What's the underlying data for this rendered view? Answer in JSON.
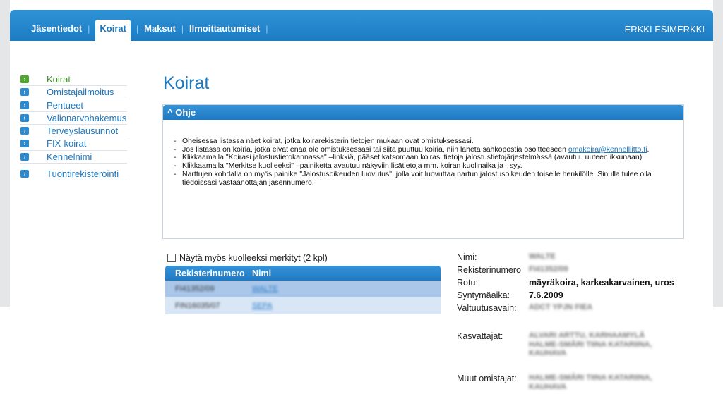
{
  "nav": {
    "items": [
      {
        "label": "Jäsentiedot",
        "active": false
      },
      {
        "label": "Koirat",
        "active": true
      },
      {
        "label": "Maksut",
        "active": false
      },
      {
        "label": "Ilmoittautumiset",
        "active": false
      }
    ],
    "user": "ERKKI ESIMERKKI"
  },
  "sidebar": {
    "items": [
      {
        "label": "Koirat",
        "active": true
      },
      {
        "label": "Omistajailmoitus"
      },
      {
        "label": "Pentueet"
      },
      {
        "label": "Valionarvohakemus"
      },
      {
        "label": "Terveyslausunnot"
      },
      {
        "label": "FIX-koirat"
      },
      {
        "label": "Kennelnimi"
      },
      {
        "label": "Tuontirekisteröinti"
      }
    ]
  },
  "page": {
    "title": "Koirat"
  },
  "ohje": {
    "header": "Ohje",
    "items": [
      "Oheisessa listassa näet koirat, jotka koirarekisterin tietojen mukaan ovat omistuksessasi.",
      "Klikkaamalla \"Koirasi jalostustietokannassa\" –linkkiä, pääset katsomaan koirasi tietoja jalostustietojärjestelmässä (avautuu uuteen ikkunaan).",
      "Klikkaamalla \"Merkitse kuolleeksi\" –painiketta avautuu näkyviin lisätietoja mm. koiran kuolinaika ja –syy.",
      "Narttujen kohdalla on myös painike \"Jalostusoikeuden luovutus\", jolla voit luovuttaa nartun jalostusoikeuden toiselle henkilölle. Sinulla tulee olla tiedoissasi vastaanottajan jäsennumero."
    ],
    "email_item": {
      "before": "Jos listassa on koiria, jotka eivät enää ole omistuksessasi tai siitä puuttuu koiria, niin lähetä sähköpostia osoitteeseen",
      "link": "omakoira@kennelliitto.fi",
      "after": "."
    }
  },
  "checkbox": {
    "label": "Näytä myös kuolleeksi merkityt (2 kpl)",
    "checked": false
  },
  "table": {
    "headers": [
      "Rekisterinumero",
      "Nimi"
    ],
    "rows": [
      {
        "reg": "FI41352/09",
        "name": "WALTE"
      },
      {
        "reg": "FIN16035/07",
        "name": "SEPA"
      }
    ]
  },
  "details": {
    "name": {
      "label": "Nimi:",
      "value": "WALTE"
    },
    "reg": {
      "label": "Rekisterinumero",
      "value": "FI41352/09"
    },
    "breed": {
      "label": "Rotu:",
      "value": "mäyräkoira, karkeakarvainen, uros"
    },
    "birth": {
      "label": "Syntymäaika:",
      "value": "7.6.2009"
    },
    "key": {
      "label": "Valtuutusavain:",
      "value": "ADCT YPJN FIEA"
    },
    "breeders": {
      "label": "Kasvattajat:",
      "lines": [
        "ALVARI ARTTU, KARHAAMYLÄ",
        "HALME-SMÅRI TIINA KATARIINA,",
        "KAUHAVA"
      ]
    },
    "owners": {
      "label": "Muut omistajat:",
      "lines": [
        "HALME-SMÅRI TIINA KATARIINA,",
        "KAUHAVA"
      ]
    }
  },
  "colors": {
    "accent": "#1e78be",
    "header": "#2a88cf",
    "active_green": "#4fa62c"
  }
}
